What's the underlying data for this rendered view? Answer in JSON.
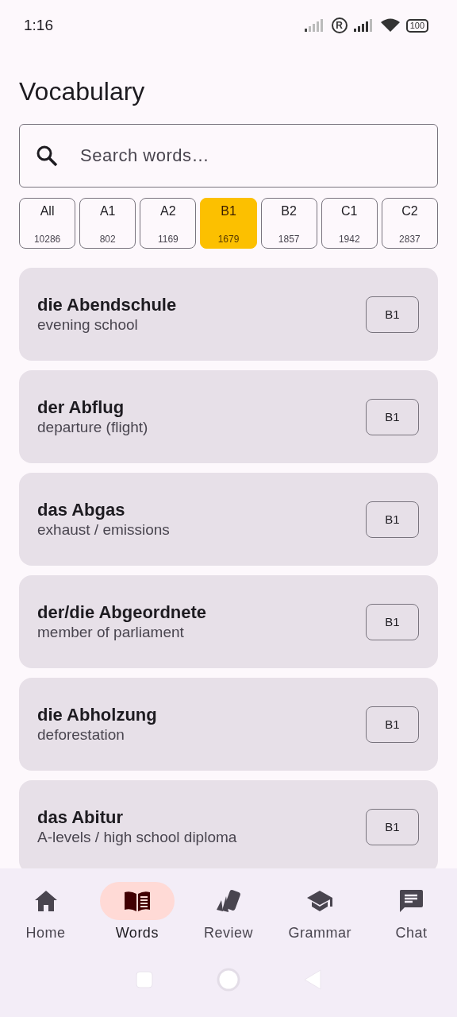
{
  "status_bar": {
    "time": "1:16",
    "roaming": "R",
    "battery": "100"
  },
  "title": "Vocabulary",
  "search": {
    "placeholder": "Search words…"
  },
  "levels": [
    {
      "label": "All",
      "count": "10286",
      "selected": false
    },
    {
      "label": "A1",
      "count": "802",
      "selected": false
    },
    {
      "label": "A2",
      "count": "1169",
      "selected": false
    },
    {
      "label": "B1",
      "count": "1679",
      "selected": true
    },
    {
      "label": "B2",
      "count": "1857",
      "selected": false
    },
    {
      "label": "C1",
      "count": "1942",
      "selected": false
    },
    {
      "label": "C2",
      "count": "2837",
      "selected": false
    }
  ],
  "words": [
    {
      "word": "die Abendschule",
      "translation": "evening school",
      "level": "B1"
    },
    {
      "word": "der Abflug",
      "translation": "departure (flight)",
      "level": "B1"
    },
    {
      "word": "das Abgas",
      "translation": "exhaust / emissions",
      "level": "B1"
    },
    {
      "word": "der/die Abgeordnete",
      "translation": "member of parliament",
      "level": "B1"
    },
    {
      "word": "die Abholzung",
      "translation": "deforestation",
      "level": "B1"
    },
    {
      "word": "das Abitur",
      "translation": "A-levels / high school diploma",
      "level": "B1"
    }
  ],
  "nav": [
    {
      "label": "Home",
      "selected": false
    },
    {
      "label": "Words",
      "selected": true
    },
    {
      "label": "Review",
      "selected": false
    },
    {
      "label": "Grammar",
      "selected": false
    },
    {
      "label": "Chat",
      "selected": false
    }
  ]
}
